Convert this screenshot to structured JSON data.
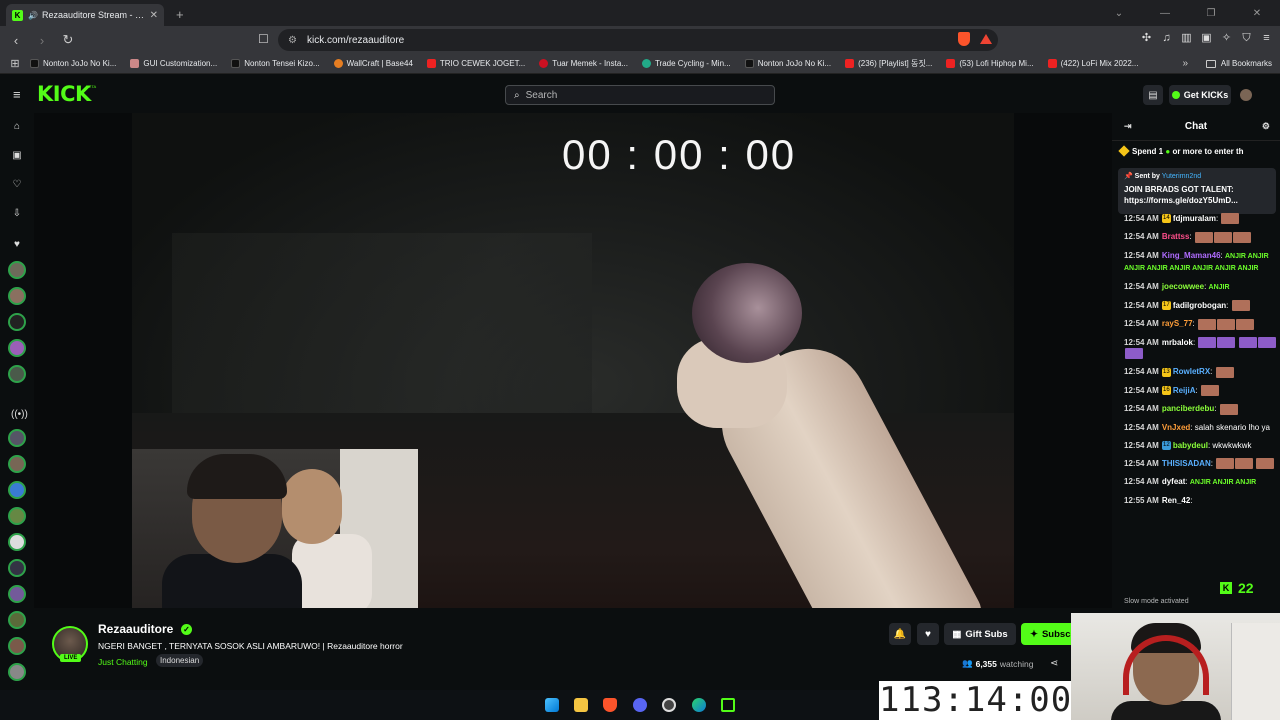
{
  "browser": {
    "tab_title": "Rezaauditore Stream - Watch",
    "url": "kick.com/rezaauditore",
    "bookmarks": [
      "Nonton JoJo No Ki...",
      "GUI Customization...",
      "Nonton Tensei Kizo...",
      "WallCraft | Base44",
      "TRIO CEWEK JOGET...",
      "Tuar Memek - Insta...",
      "Trade Cycling - Min...",
      "Nonton JoJo No Ki...",
      "(236) [Playlist] 동짓...",
      "(53) Lofi Hiphop Mi...",
      "(422) LoFi Mix 2022..."
    ],
    "all_bookmarks": "All Bookmarks"
  },
  "kick": {
    "search_placeholder": "Search",
    "get_kicks": "Get KICKs"
  },
  "video": {
    "timer": "00 : 00 : 00"
  },
  "stream": {
    "streamer": "Rezaauditore",
    "live": "LIVE",
    "title": "NGERI BANGET , TERNYATA SOSOK ASLI AMBARUWO! | Rezaauditore horror",
    "category": "Just Chatting",
    "tag": "Indonesian",
    "gift_subs": "Gift Subs",
    "subscribe": "Subscribe",
    "viewers": "6,355",
    "watching": "watching"
  },
  "chat": {
    "title": "Chat",
    "kick_bar": "Spend 1",
    "kick_bar_rest": "or more to enter th",
    "pinned_sent_by": "Sent by",
    "pinned_user": "Yuterimn2nd",
    "pinned_msg": "JOIN BRRADS GOT TALENT:",
    "pinned_link": "https://forms.gle/dozY5UmD...",
    "messages": [
      {
        "time": "12:54 AM",
        "user": "fdjmuralam",
        "color": "#ffffff",
        "text": ""
      },
      {
        "time": "12:54 AM",
        "user": "Brattss",
        "color": "#ff4f8b",
        "text": ""
      },
      {
        "time": "12:54 AM",
        "user": "King_Maman46",
        "color": "#b06cff",
        "text": ""
      },
      {
        "time": "12:54 AM",
        "user": "joecowwee",
        "color": "#8bff3a",
        "text": ""
      },
      {
        "time": "12:54 AM",
        "user": "fadilgrobogan",
        "color": "#ffffff",
        "text": ""
      },
      {
        "time": "12:54 AM",
        "user": "rayS_77",
        "color": "#ff9e3a",
        "text": ""
      },
      {
        "time": "12:54 AM",
        "user": "mrbalok",
        "color": "#ffffff",
        "text": ""
      },
      {
        "time": "12:54 AM",
        "user": "RowletRX",
        "color": "#5ab0ff",
        "text": ""
      },
      {
        "time": "12:54 AM",
        "user": "ReijiA",
        "color": "#5ab0ff",
        "text": ""
      },
      {
        "time": "12:54 AM",
        "user": "panciberdebu",
        "color": "#8bff3a",
        "text": ""
      },
      {
        "time": "12:54 AM",
        "user": "VnJxed",
        "color": "#ff9e3a",
        "text": "salah skenario lho ya"
      },
      {
        "time": "12:54 AM",
        "user": "babydeul",
        "color": "#8bff3a",
        "text": "wkwkwkwk"
      },
      {
        "time": "12:54 AM",
        "user": "THISISADAN",
        "color": "#5ab0ff",
        "text": ""
      },
      {
        "time": "12:54 AM",
        "user": "dyfeat",
        "color": "#ffffff",
        "text": ""
      },
      {
        "time": "12:55 AM",
        "user": "Ren_42",
        "color": "#ffffff",
        "text": ""
      }
    ],
    "slow_mode": "Slow mode activated",
    "kk_count": "22"
  },
  "overlay": {
    "clock": "113:14:00"
  },
  "colors": {
    "kick_green": "#53fc18",
    "background": "#0b0e0f"
  }
}
